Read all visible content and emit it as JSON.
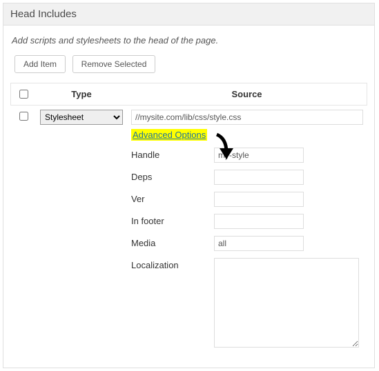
{
  "panel": {
    "title": "Head Includes",
    "description": "Add scripts and stylesheets to the head of the page."
  },
  "buttons": {
    "add": "Add Item",
    "remove": "Remove Selected"
  },
  "columns": {
    "type": "Type",
    "source": "Source"
  },
  "row": {
    "type_value": "Stylesheet",
    "source_value": "//mysite.com/lib/css/style.css",
    "advanced_label": "Advanced Options",
    "fields": {
      "handle": {
        "label": "Handle",
        "value": "my-style"
      },
      "deps": {
        "label": "Deps",
        "value": ""
      },
      "ver": {
        "label": "Ver",
        "value": ""
      },
      "footer": {
        "label": "In footer",
        "value": ""
      },
      "media": {
        "label": "Media",
        "value": "all"
      },
      "local": {
        "label": "Localization",
        "value": ""
      }
    }
  }
}
